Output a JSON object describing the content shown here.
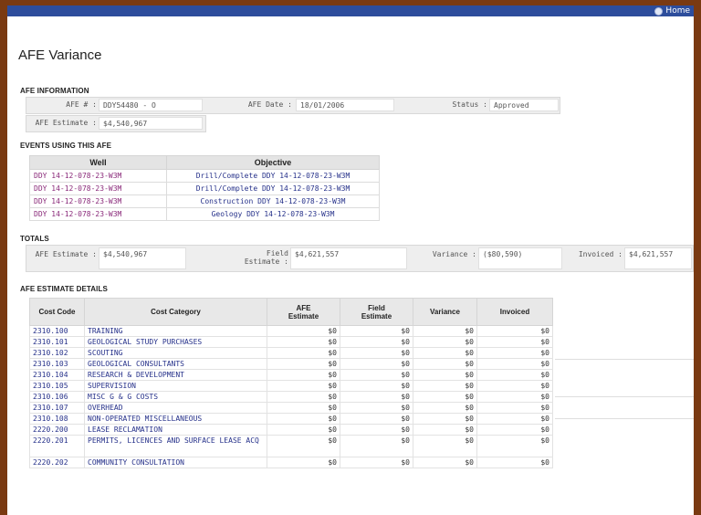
{
  "header": {
    "home_label": "Home"
  },
  "page": {
    "title": "AFE Variance"
  },
  "afe_info": {
    "section_label": "AFE INFORMATION",
    "afe_no_label": "AFE # :",
    "afe_no": "DDY54480 - O",
    "afe_date_label": "AFE Date :",
    "afe_date": "18/01/2006",
    "status_label": "Status :",
    "status": "Approved",
    "estimate_label": "AFE Estimate :",
    "estimate": "$4,540,967"
  },
  "events": {
    "section_label": "EVENTS USING THIS AFE",
    "headers": [
      "Well",
      "Objective"
    ],
    "rows": [
      {
        "well": "DDY 14-12-078-23-W3M",
        "objective": "Drill/Complete DDY 14-12-078-23-W3M"
      },
      {
        "well": "DDY 14-12-078-23-W3M",
        "objective": "Drill/Complete DDY 14-12-078-23-W3M"
      },
      {
        "well": "DDY 14-12-078-23-W3M",
        "objective": "Construction DDY 14-12-078-23-W3M"
      },
      {
        "well": "DDY 14-12-078-23-W3M",
        "objective": "Geology DDY 14-12-078-23-W3M"
      }
    ]
  },
  "totals": {
    "section_label": "TOTALS",
    "afe_estimate_label": "AFE Estimate :",
    "afe_estimate": "$4,540,967",
    "field_estimate_label_1": "Field",
    "field_estimate_label_2": "Estimate :",
    "field_estimate": "$4,621,557",
    "variance_label": "Variance :",
    "variance": "($80,590)",
    "invoiced_label": "Invoiced :",
    "invoiced": "$4,621,557"
  },
  "details": {
    "section_label": "AFE ESTIMATE DETAILS",
    "headers": {
      "code": "Cost Code",
      "category": "Cost Category",
      "afe_1": "AFE",
      "afe_2": "Estimate",
      "field_1": "Field",
      "field_2": "Estimate",
      "variance": "Variance",
      "invoiced": "Invoiced"
    },
    "rows": [
      {
        "code": "2310.100",
        "category": "TRAINING",
        "afe": "$0",
        "field": "$0",
        "variance": "$0",
        "invoiced": "$0"
      },
      {
        "code": "2310.101",
        "category": "GEOLOGICAL STUDY PURCHASES",
        "afe": "$0",
        "field": "$0",
        "variance": "$0",
        "invoiced": "$0"
      },
      {
        "code": "2310.102",
        "category": "SCOUTING",
        "afe": "$0",
        "field": "$0",
        "variance": "$0",
        "invoiced": "$0"
      },
      {
        "code": "2310.103",
        "category": "GEOLOGICAL CONSULTANTS",
        "afe": "$0",
        "field": "$0",
        "variance": "$0",
        "invoiced": "$0"
      },
      {
        "code": "2310.104",
        "category": "RESEARCH & DEVELOPMENT",
        "afe": "$0",
        "field": "$0",
        "variance": "$0",
        "invoiced": "$0"
      },
      {
        "code": "2310.105",
        "category": "SUPERVISION",
        "afe": "$0",
        "field": "$0",
        "variance": "$0",
        "invoiced": "$0"
      },
      {
        "code": "2310.106",
        "category": "MISC G & G COSTS",
        "afe": "$0",
        "field": "$0",
        "variance": "$0",
        "invoiced": "$0"
      },
      {
        "code": "2310.107",
        "category": "OVERHEAD",
        "afe": "$0",
        "field": "$0",
        "variance": "$0",
        "invoiced": "$0"
      },
      {
        "code": "2310.108",
        "category": "NON-OPERATED MISCELLANEOUS",
        "afe": "$0",
        "field": "$0",
        "variance": "$0",
        "invoiced": "$0"
      },
      {
        "code": "2220.200",
        "category": "LEASE RECLAMATION",
        "afe": "$0",
        "field": "$0",
        "variance": "$0",
        "invoiced": "$0"
      },
      {
        "code": "2220.201",
        "category": "PERMITS, LICENCES AND SURFACE LEASE ACQ",
        "afe": "$0",
        "field": "$0",
        "variance": "$0",
        "invoiced": "$0"
      },
      {
        "code": "2220.202",
        "category": "COMMUNITY CONSULTATION",
        "afe": "$0",
        "field": "$0",
        "variance": "$0",
        "invoiced": "$0"
      }
    ]
  }
}
